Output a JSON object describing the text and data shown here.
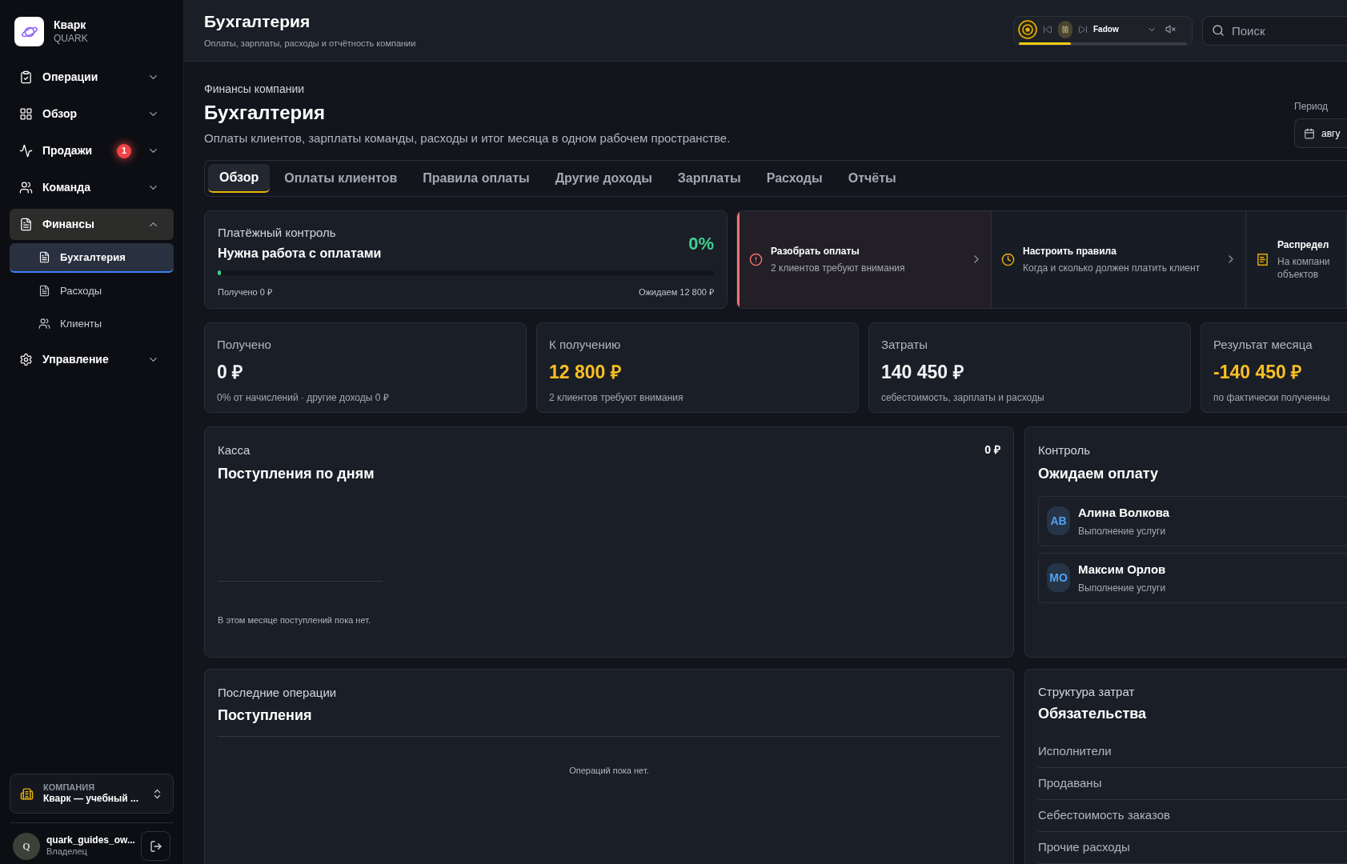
{
  "sidebar": {
    "brand": {
      "name": "Кварк",
      "subtitle": "QUARK"
    },
    "items": [
      {
        "label": "Операции",
        "expanded": false
      },
      {
        "label": "Обзор",
        "expanded": false
      },
      {
        "label": "Продажи",
        "badge": "1",
        "expanded": false
      },
      {
        "label": "Команда",
        "expanded": false
      },
      {
        "label": "Финансы",
        "expanded": true,
        "children": [
          {
            "label": "Бухгалтерия",
            "selected": true
          },
          {
            "label": "Расходы",
            "selected": false
          },
          {
            "label": "Клиенты",
            "selected": false
          }
        ]
      },
      {
        "label": "Управление",
        "expanded": false
      }
    ],
    "company": {
      "caption": "КОМПАНИЯ",
      "name": "Кварк — учебный ..."
    },
    "user": {
      "avatar": "Q",
      "name": "quark_guides_ow...",
      "role": "Владелец"
    }
  },
  "header": {
    "title": "Бухгалтерия",
    "subtitle": "Оплаты, зарплаты, расходы и отчётность компании"
  },
  "player": {
    "track": "Fadow",
    "playing": true,
    "muted": true,
    "level": 0.31
  },
  "search": {
    "placeholder": "Поиск"
  },
  "page": {
    "breadcrumb": "Финансы компании",
    "title": "Бухгалтерия",
    "description": "Оплаты клиентов, зарплаты команды, расходы и итог месяца в одном рабочем пространстве.",
    "period": {
      "label": "Период",
      "value": "авгу"
    }
  },
  "tabs": [
    {
      "label": "Обзор",
      "selected": true
    },
    {
      "label": "Оплаты клиентов",
      "selected": false
    },
    {
      "label": "Правила оплаты",
      "selected": false
    },
    {
      "label": "Другие доходы",
      "selected": false
    },
    {
      "label": "Зарплаты",
      "selected": false
    },
    {
      "label": "Расходы",
      "selected": false
    },
    {
      "label": "Отчёты",
      "selected": false
    }
  ],
  "payment_control": {
    "caption": "Платёжный контроль",
    "title": "Нужна работа с оплатами",
    "percent": "0%",
    "level": 0,
    "received": "Получено 0 ₽",
    "expected": "Ожидаем 12 800 ₽"
  },
  "actions": [
    {
      "kind": "alert",
      "title": "Разобрать оплаты",
      "text": "2 клиентов требуют внимания",
      "arrow": true
    },
    {
      "kind": "normal",
      "title": "Настроить правила",
      "text": "Когда и сколько должен платить клиент",
      "arrow": true
    },
    {
      "kind": "normal",
      "title": "Распредел",
      "text": "На компани объектов",
      "arrow": false
    }
  ],
  "stats": [
    {
      "label": "Получено",
      "value": "0 ₽",
      "color": "#f3f4f6",
      "note": "0% от начислений · другие доходы 0 ₽"
    },
    {
      "label": "К получению",
      "value": "12 800 ₽",
      "color": "#fbbf24",
      "note": "2 клиентов требуют внимания"
    },
    {
      "label": "Затраты",
      "value": "140 450 ₽",
      "color": "#f3f4f6",
      "note": "себестоимость, зарплаты и расходы"
    },
    {
      "label": "Результат месяца",
      "value": "-140 450 ₽",
      "color": "#fbbf24",
      "note": "по фактически полученны"
    }
  ],
  "cash": {
    "caption": "Касса",
    "title": "Поступления по дням",
    "total": "0 ₽",
    "empty": "В этом месяце поступлений пока нет."
  },
  "awaiting": {
    "caption": "Контроль",
    "title": "Ожидаем оплату",
    "clients": [
      {
        "initials": "АВ",
        "name": "Алина Волкова",
        "service": "Выполнение услуги"
      },
      {
        "initials": "МО",
        "name": "Максим Орлов",
        "service": "Выполнение услуги"
      }
    ]
  },
  "operations": {
    "caption": "Последние операции",
    "title": "Поступления",
    "empty": "Операций пока нет."
  },
  "costs": {
    "caption": "Структура затрат",
    "title": "Обязательства",
    "rows": [
      "Исполнители",
      "Продаваны",
      "Себестоимость заказов",
      "Прочие расходы"
    ]
  }
}
